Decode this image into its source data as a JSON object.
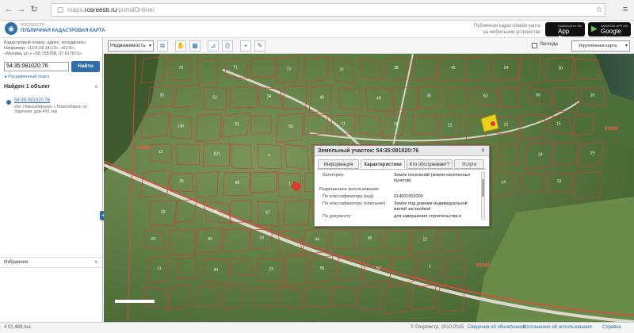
{
  "browser": {
    "url_prefix": "maps.",
    "url_domain": "rosreestr.ru",
    "url_path": "/portalOnline/"
  },
  "header": {
    "logo_small": "РОСРЕЕСТР",
    "logo_title": "ПУБЛИЧНАЯ КАДАСТРОВАЯ КАРТА",
    "promo_line1": "Публичная кадастровая карта",
    "promo_line2": "на мобильном устройстве",
    "app_store_small": "Download on the",
    "app_store_label": "App Store",
    "google_play_small": "ANDROID APP ON",
    "google_play_label": "Google play"
  },
  "left_panel": {
    "search_hint_line1": "Кадастровый номер, адрес, координаты",
    "search_hint_line2": "Например: «11:6:19:14:13», «61:8»,",
    "search_hint_line3": "«Москва, ул.» «55.755768, 37.617671»",
    "search_value": "54:35:081020:76",
    "find_label": "Найти",
    "advanced_label": "▸ Расширенный поиск",
    "found_title": "Найден 1 объект",
    "result_id": "54:35:081020:76",
    "result_address": "обл. Новосибирская, г. Новосибирск, ул. Заречная, дом 49/1 кор",
    "favorites_label": "Избранное",
    "close_symbol": "×",
    "collapse_symbol": "◂"
  },
  "toolbar": {
    "layer_value": "Недвижимость",
    "legend_label": "Легенда",
    "basemap_value": "Укрупнённая карта"
  },
  "map": {
    "plot_labels": [
      "70",
      "71",
      "73",
      "37",
      "38",
      "42",
      "54",
      "30",
      "35",
      "52",
      "34",
      "48",
      "49",
      "36",
      "63",
      "66",
      "16",
      "140",
      "51",
      "56",
      "11",
      "18",
      "22",
      "21",
      "15",
      "12",
      "101",
      "4",
      "3",
      "27",
      "37",
      "56",
      "24",
      "25",
      "35",
      "86",
      "1",
      "6",
      "22",
      "13",
      "14",
      "19",
      "23",
      "41",
      "47",
      "53",
      "62",
      "63",
      "64",
      "65",
      "40",
      "44",
      "45",
      "12",
      "11",
      "20",
      "23",
      "95",
      "57",
      "1"
    ],
    "quarter_labels": [
      "81020",
      "81020",
      "81009"
    ]
  },
  "popup": {
    "title": "Земельный участок: 54:35:081020:76",
    "close_symbol": "×",
    "tabs": [
      "Информация",
      "Характеристики",
      "Кто обслуживает?",
      "Услуги"
    ],
    "category_label": "Категория:",
    "category_value": "Земли поселений (земли населенных пунктов)",
    "permitted_use_label": "Разрешенное использование:",
    "by_classifier_code_label": "По классификатору (код):",
    "by_classifier_code_value": "014001002000",
    "by_classifier_desc_label": "По классификатору (описание):",
    "by_classifier_desc_value": "Земли под домами индивидуальной жилой застройкой",
    "by_document_label": "По документу:",
    "by_document_value": "для завершения строительства и"
  },
  "status": {
    "left": "4 01 489 пкз",
    "copyright": "© Росреестр, 2010-2015",
    "link1": "Сведения об обновлениях",
    "link2": "Соглашение об использовании",
    "link3": "Справка"
  },
  "colors": {
    "accent": "#2f6ea8",
    "parcel_border": "#c8413b",
    "selected_parcel": "#e8d21c",
    "road": "#d9d4c8"
  }
}
